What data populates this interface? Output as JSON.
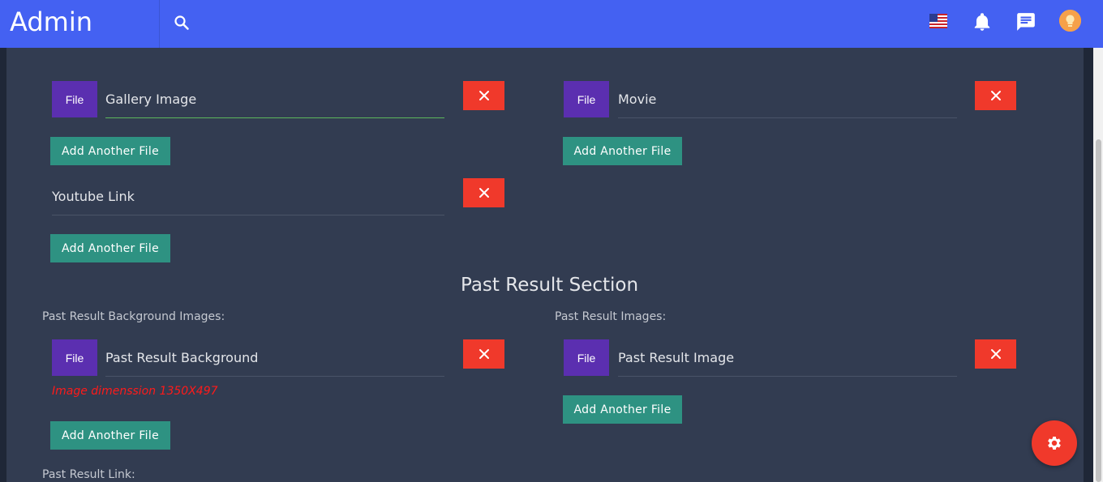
{
  "header": {
    "brand": "Admin",
    "icons": [
      "search-icon",
      "us-flag-icon",
      "bell-icon",
      "chat-icon",
      "avatar"
    ]
  },
  "gallery": {
    "file_tag": "File",
    "field_value": "Gallery Image",
    "add_label": "Add Another File"
  },
  "movie": {
    "file_tag": "File",
    "field_value": "Movie",
    "add_label": "Add Another File"
  },
  "youtube": {
    "field_value": "Youtube Link",
    "add_label": "Add Another File"
  },
  "past_result": {
    "section_title": "Past Result Section",
    "background_label": "Past Result Background Images:",
    "background_file_tag": "File",
    "background_field_value": "Past Result Background",
    "background_hint": "Image dimenssion 1350X497",
    "background_add_label": "Add Another File",
    "images_label": "Past Result Images:",
    "images_file_tag": "File",
    "images_field_value": "Past Result Image",
    "images_add_label": "Add Another File",
    "link_label": "Past Result Link:"
  },
  "colors": {
    "header_bg": "#4461f2",
    "content_bg": "#323c51",
    "file_tag_bg": "#5b2fb0",
    "delete_bg": "#f0392b",
    "add_bg": "#2e9282",
    "hint_color": "#ff1a1a"
  }
}
